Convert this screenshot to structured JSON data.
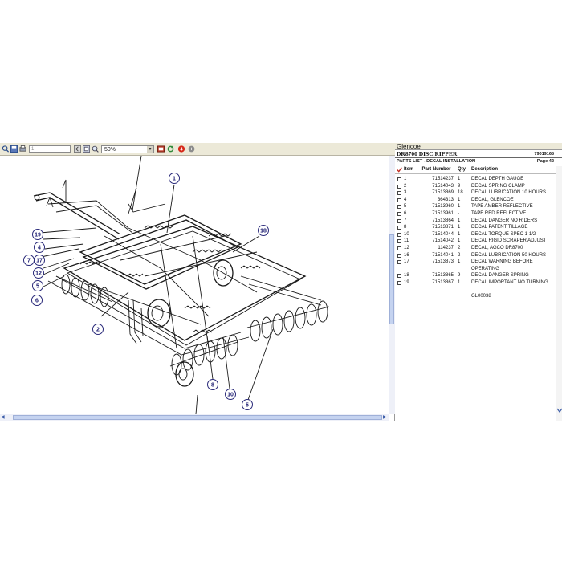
{
  "toolbar": {
    "page_value": "1",
    "zoom_value": "50%",
    "icons": [
      "search-icon",
      "save-icon",
      "print-icon",
      "first-page-icon",
      "prev-page-icon",
      "next-page-icon",
      "refresh-icon",
      "tree-icon",
      "stop-icon",
      "info-icon"
    ]
  },
  "parts_panel": {
    "brand": "Glencoe",
    "model": "DR8700 DISC RIPPER",
    "pub_no": "79019168",
    "list_title": "PARTS LIST - DECAL INSTALLATION",
    "page": "Page 42",
    "headers": {
      "item": "Item",
      "part": "Part Number",
      "qty": "Qty",
      "desc": "Description"
    },
    "rows": [
      {
        "item": "1",
        "part": "71514237",
        "qty": "1",
        "desc": "DECAL DEPTH GAUGE"
      },
      {
        "item": "2",
        "part": "71514043",
        "qty": "9",
        "desc": "DECAL SPRING CLAMP"
      },
      {
        "item": "3",
        "part": "71513869",
        "qty": "18",
        "desc": "DECAL LUBRICATION 10 HOURS"
      },
      {
        "item": "4",
        "part": "364313",
        "qty": "1",
        "desc": "DECAL, GLENCOE"
      },
      {
        "item": "5",
        "part": "71513960",
        "qty": "1",
        "desc": "TAPE AMBER REFLECTIVE"
      },
      {
        "item": "6",
        "part": "71513961",
        "qty": "-",
        "desc": "TAPE RED REFLECTIVE"
      },
      {
        "item": "7",
        "part": "71513864",
        "qty": "1",
        "desc": "DECAL DANGER NO RIDERS"
      },
      {
        "item": "8",
        "part": "71513871",
        "qty": "1",
        "desc": "DECAL PATENT TILLAGE"
      },
      {
        "item": "10",
        "part": "71514044",
        "qty": "1",
        "desc": "DECAL TORQUE SPEC 1-1/2"
      },
      {
        "item": "11",
        "part": "71514042",
        "qty": "1",
        "desc": "DECAL RIGID SCRAPER ADJUST"
      },
      {
        "item": "12",
        "part": "114237",
        "qty": "2",
        "desc": "DECAL, AGCO DR8700"
      },
      {
        "item": "16",
        "part": "71514041",
        "qty": "2",
        "desc": "DECAL LUBRICATION 50 HOURS"
      },
      {
        "item": "17",
        "part": "71513873",
        "qty": "1",
        "desc": "DECAL WARNING BEFORE OPERATING"
      },
      {
        "item": "18",
        "part": "71513865",
        "qty": "9",
        "desc": "DECAL DANGER SPRING"
      },
      {
        "item": "19",
        "part": "71513867",
        "qty": "1",
        "desc": "DECAL IMPORTANT NO TURNING"
      }
    ],
    "footer_code": "GL00038"
  },
  "callouts": [
    "1",
    "2",
    "4",
    "5",
    "6",
    "7",
    "8",
    "10",
    "11",
    "12",
    "17",
    "18",
    "19"
  ]
}
